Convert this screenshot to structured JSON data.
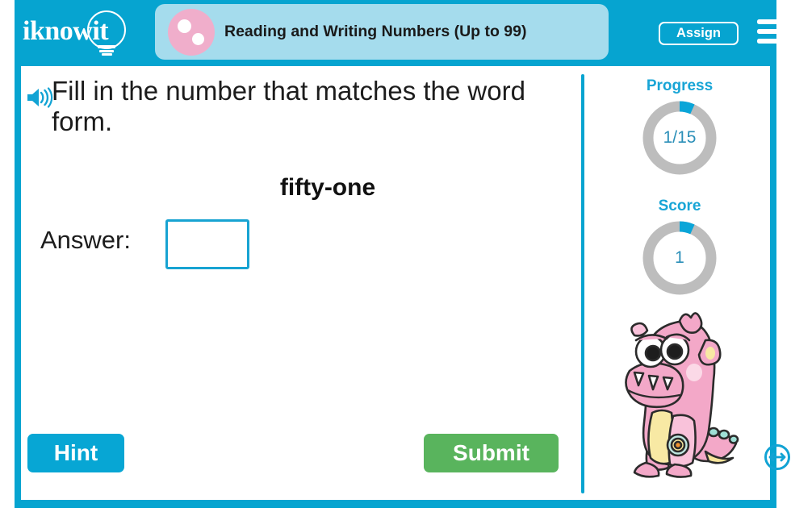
{
  "brand": {
    "logo_text": "iknowit",
    "logo_icon": "lightbulb-icon",
    "frame_color": "#06a4d0"
  },
  "header": {
    "title": "Reading and Writing Numbers (Up to 99)",
    "title_pill_color": "#a5dced",
    "title_icon": "pink-circle-dots-icon",
    "assign_label": "Assign",
    "menu_icon": "hamburger-menu-icon"
  },
  "question": {
    "audio_icon": "speaker-icon",
    "prompt": "Fill in the number that matches the word form.",
    "word_form": "fifty-one",
    "answer_label": "Answer:",
    "answer_value": "",
    "answer_placeholder": ""
  },
  "actions": {
    "hint_label": "Hint",
    "hint_color": "#07a6d4",
    "submit_label": "Submit",
    "submit_color": "#59b45d"
  },
  "sidebar": {
    "progress": {
      "label": "Progress",
      "value": "1/15",
      "current": 1,
      "total": 15,
      "percent": 6.7,
      "arc_color": "#0aa5d8",
      "track_color": "#bdbdbd"
    },
    "score": {
      "label": "Score",
      "value": "1",
      "percent": 6.7,
      "arc_color": "#0aa5d8",
      "track_color": "#bdbdbd"
    },
    "mascot": "pink-monster-mascot",
    "resize_icon": "resize-horizontal-icon"
  }
}
